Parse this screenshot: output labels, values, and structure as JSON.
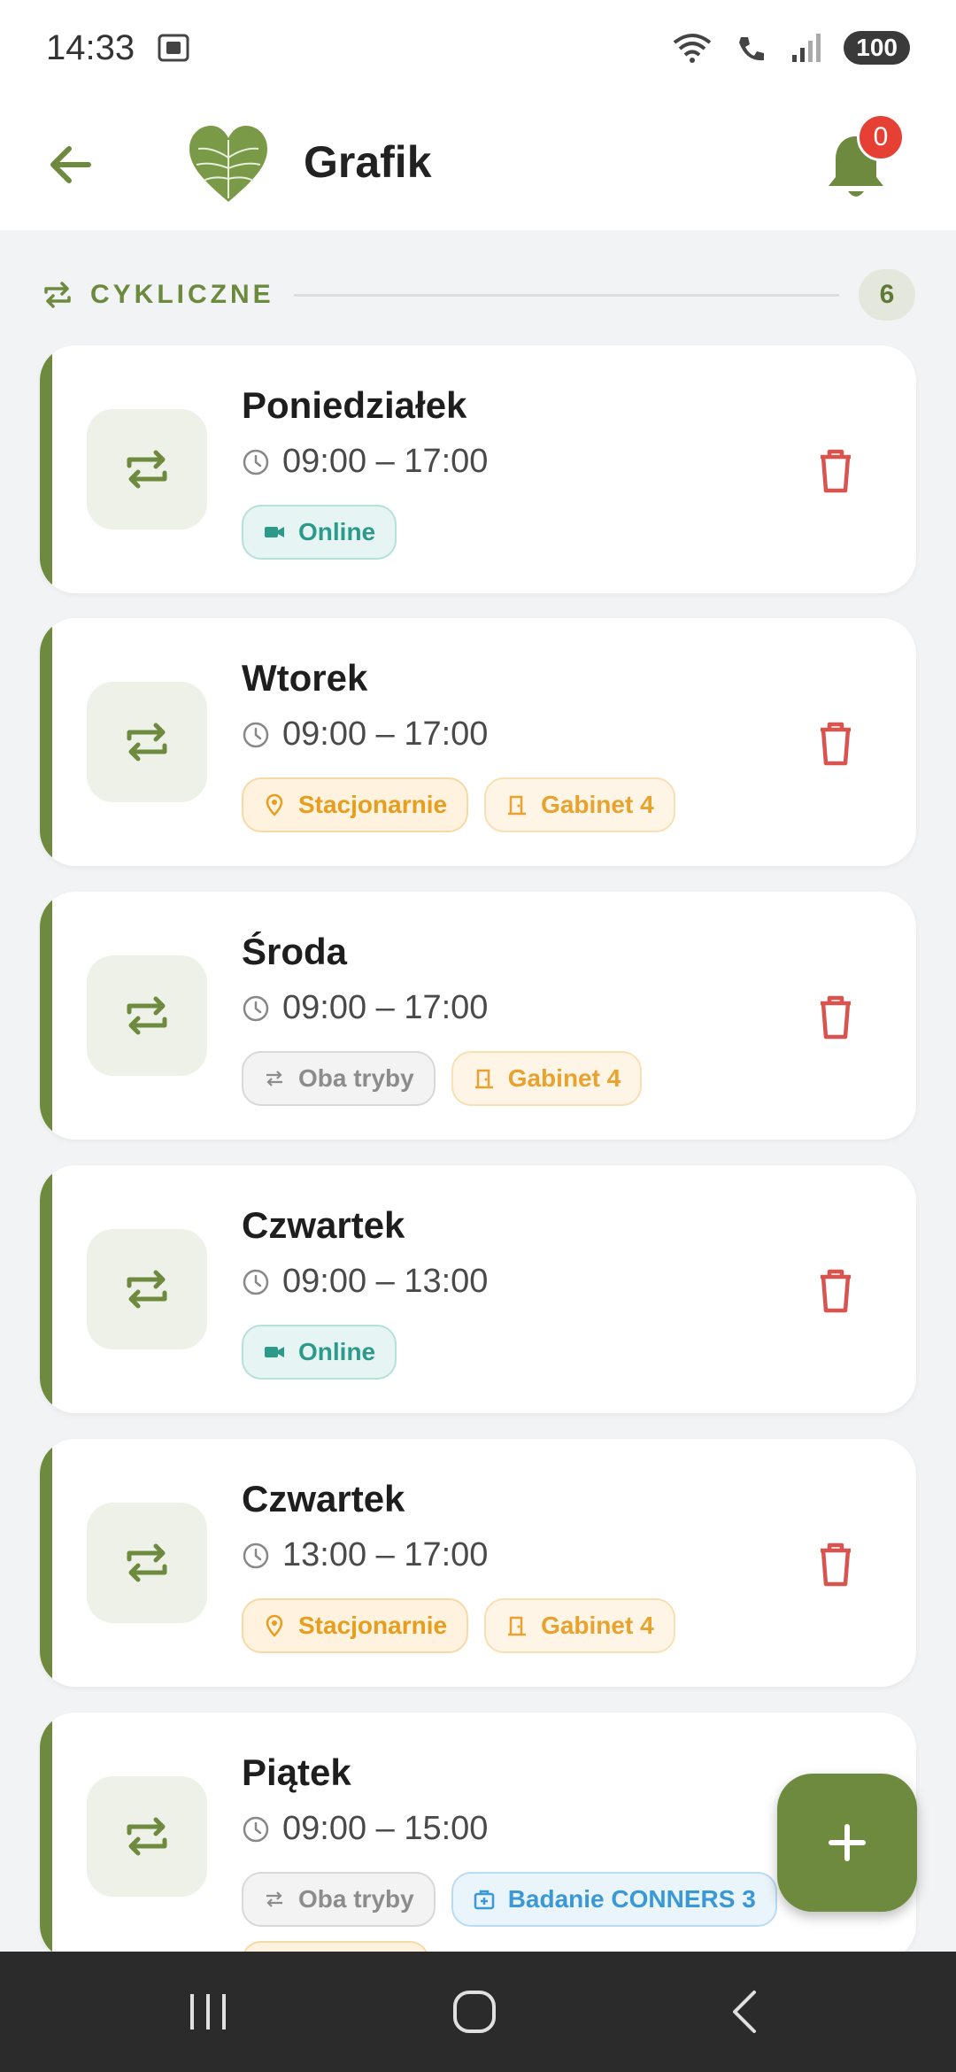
{
  "status": {
    "time": "14:33",
    "battery": "100"
  },
  "appbar": {
    "title": "Grafik",
    "notifications_count": "0"
  },
  "section": {
    "title": "CYKLICZNE",
    "count": "6"
  },
  "colors": {
    "accent": "#6d8a3e",
    "danger": "#d9534f"
  },
  "cards": [
    {
      "day": "Poniedziałek",
      "time": "09:00 – 17:00",
      "tags": [
        {
          "kind": "online",
          "icon": "video-icon",
          "label": "Online"
        }
      ]
    },
    {
      "day": "Wtorek",
      "time": "09:00 – 17:00",
      "tags": [
        {
          "kind": "stac",
          "icon": "location-pin-icon",
          "label": "Stacjonarnie"
        },
        {
          "kind": "gab",
          "icon": "door-icon",
          "label": "Gabinet 4"
        }
      ]
    },
    {
      "day": "Środa",
      "time": "09:00 – 17:00",
      "tags": [
        {
          "kind": "oba",
          "icon": "swap-arrows-icon",
          "label": "Oba tryby"
        },
        {
          "kind": "gab",
          "icon": "door-icon",
          "label": "Gabinet 4"
        }
      ]
    },
    {
      "day": "Czwartek",
      "time": "09:00 – 13:00",
      "tags": [
        {
          "kind": "online",
          "icon": "video-icon",
          "label": "Online"
        }
      ]
    },
    {
      "day": "Czwartek",
      "time": "13:00 – 17:00",
      "tags": [
        {
          "kind": "stac",
          "icon": "location-pin-icon",
          "label": "Stacjonarnie"
        },
        {
          "kind": "gab",
          "icon": "door-icon",
          "label": "Gabinet 4"
        }
      ]
    },
    {
      "day": "Piątek",
      "time": "09:00 – 15:00",
      "tags": [
        {
          "kind": "oba",
          "icon": "swap-arrows-icon",
          "label": "Oba tryby"
        },
        {
          "kind": "bad",
          "icon": "medical-case-icon",
          "label": "Badanie CONNERS 3"
        }
      ]
    }
  ]
}
